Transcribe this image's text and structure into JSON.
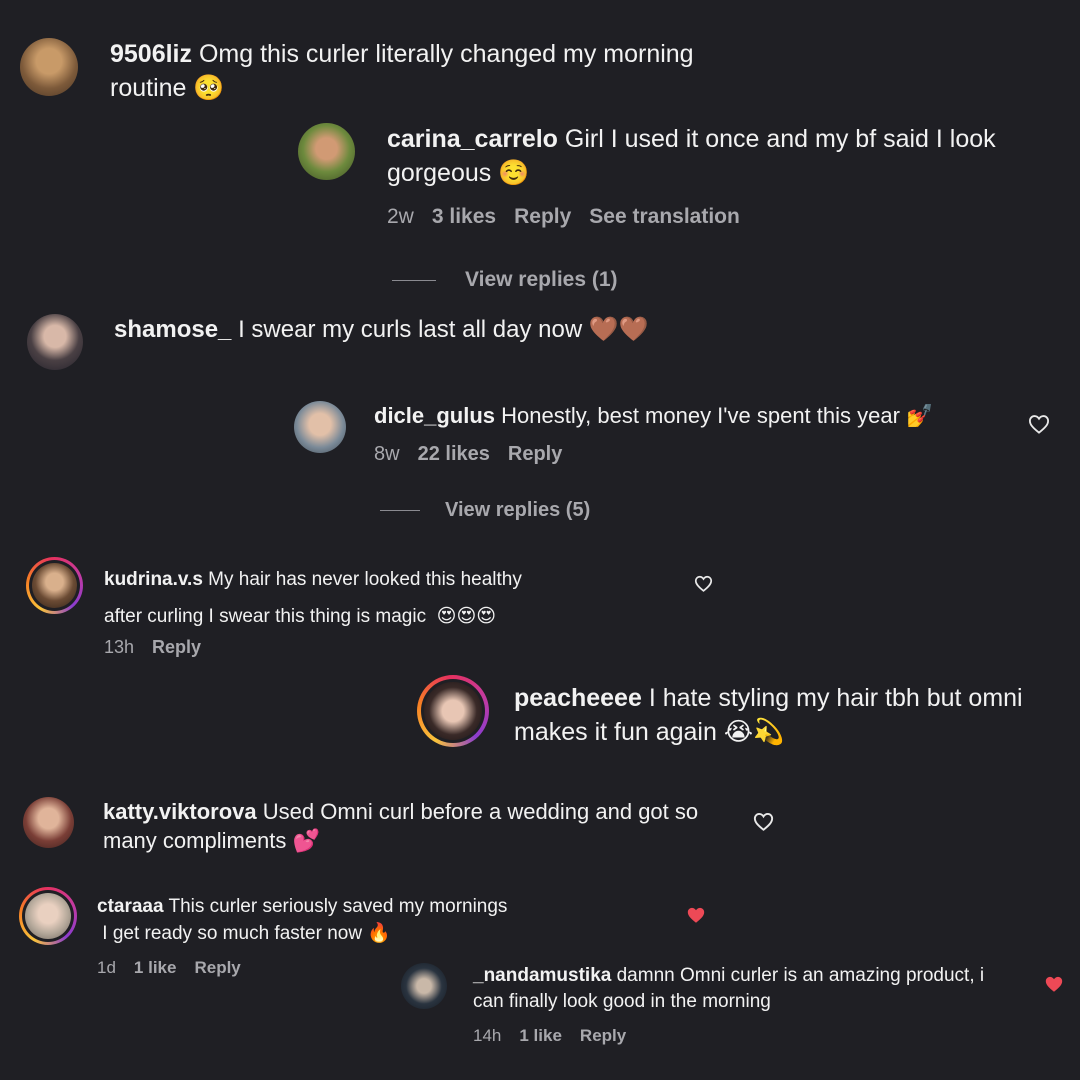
{
  "colors": {
    "background": "#1f1f24",
    "text": "#f2f2f2",
    "muted": "#a8a8ad",
    "liked_heart": "#ed4956"
  },
  "comments": [
    {
      "username": "9506liz",
      "text": " Omg this curler literally changed my morning",
      "text2": "routine",
      "emoji": "🥺"
    },
    {
      "username": "carina_carrelo",
      "text": " Girl I used it once and my bf said I look",
      "text2": "gorgeous",
      "emoji": "☺️",
      "time": "2w",
      "likes": "3 likes",
      "reply": "Reply",
      "translate": "See translation",
      "view_replies": "View replies (1)"
    },
    {
      "username": "shamose_",
      "text": " I swear my curls last all day now",
      "emoji": "🤎🤎"
    },
    {
      "username": "dicle_gulus",
      "text": " Honestly, best money I've spent this year",
      "emoji": "💅",
      "time": "8w",
      "likes": "22 likes",
      "reply": "Reply",
      "view_replies": "View replies (5)"
    },
    {
      "username": "kudrina.v.s",
      "text": " My hair has never looked this healthy",
      "text2": "after curling I swear this thing is magic",
      "emoji": "😍😍😍",
      "time": "13h",
      "reply": "Reply"
    },
    {
      "username": "peacheeee",
      "text": " I hate styling my hair tbh but omni",
      "text2": "makes it fun again",
      "emoji": "😭💫"
    },
    {
      "username": "katty.viktorova",
      "text": " Used Omni curl before a wedding and got so",
      "text2": "many compliments",
      "emoji": "💕"
    },
    {
      "username": "ctaraaa",
      "text": " This curler seriously saved my mornings",
      "text2": "I get ready so much faster now",
      "emoji": "🔥",
      "time": "1d",
      "likes": "1 like",
      "reply": "Reply"
    },
    {
      "username": "_nandamustika",
      "text": " damnn Omni curler is an amazing product, i",
      "text2": "can finally look good in the morning",
      "time": "14h",
      "likes": "1 like",
      "reply": "Reply"
    }
  ]
}
